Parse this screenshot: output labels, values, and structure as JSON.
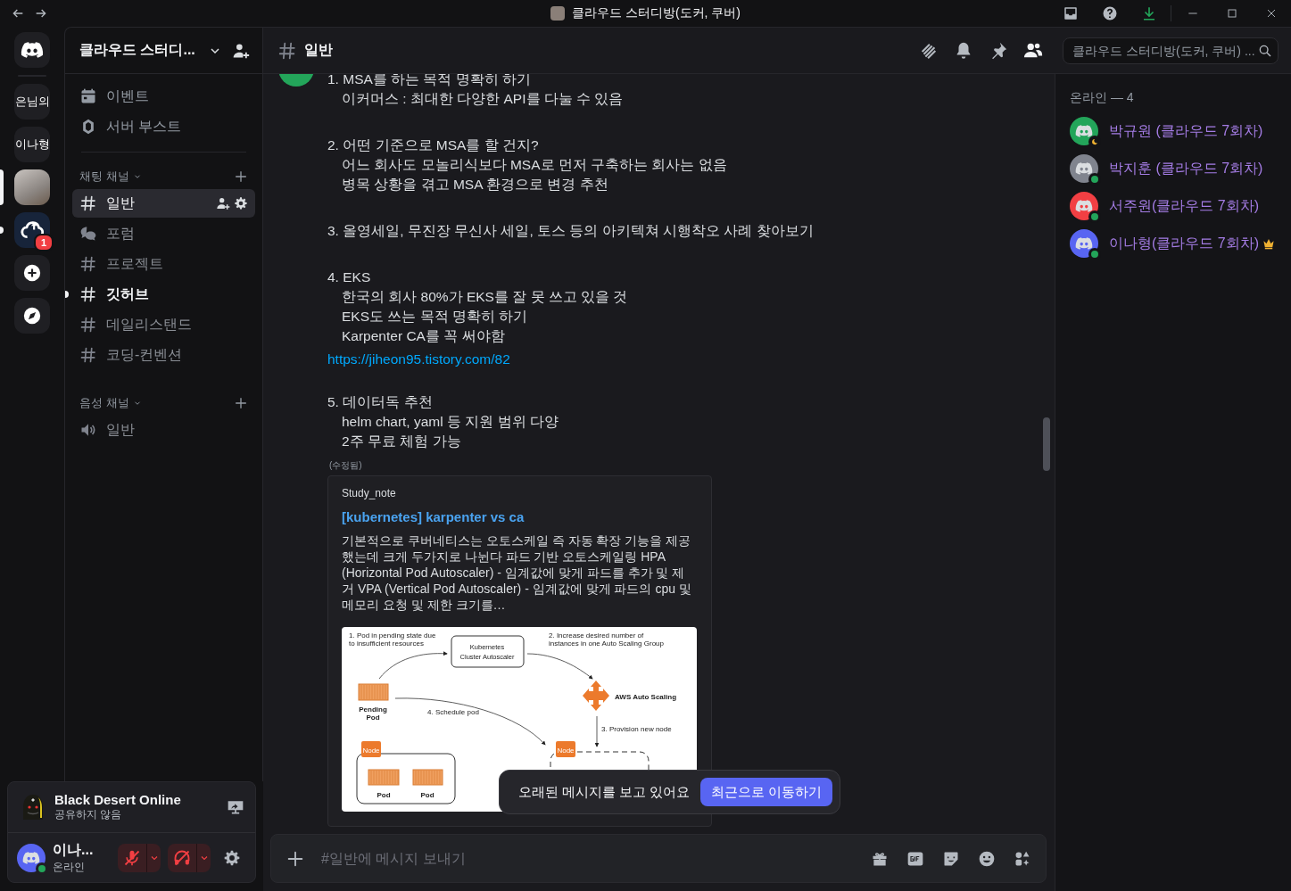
{
  "window": {
    "title": "클라우드 스터디방(도커, 쿠버)"
  },
  "servers": [
    {
      "kind": "home",
      "selected": false,
      "unread": false
    },
    {
      "kind": "text",
      "label": "은님의",
      "selected": false,
      "unread": false
    },
    {
      "kind": "text",
      "label": "이나형",
      "selected": false,
      "unread": false
    },
    {
      "kind": "photo",
      "selected": true,
      "unread": false
    },
    {
      "kind": "cloud",
      "selected": false,
      "unread": true,
      "badge": "1"
    },
    {
      "kind": "add",
      "selected": false,
      "unread": false
    },
    {
      "kind": "discover",
      "selected": false,
      "unread": false
    }
  ],
  "sidebar": {
    "server_name": "클라우드 스터디...",
    "shortcuts": [
      {
        "kind": "events",
        "label": "이벤트"
      },
      {
        "kind": "boost",
        "label": "서버 부스트"
      }
    ],
    "categories": [
      {
        "name": "채팅 채널",
        "channels": [
          {
            "kind": "text",
            "name": "일반",
            "selected": true,
            "unread": false
          },
          {
            "kind": "forum",
            "name": "포럼",
            "selected": false,
            "unread": false
          },
          {
            "kind": "text",
            "name": "프로젝트",
            "selected": false,
            "unread": false
          },
          {
            "kind": "text",
            "name": "깃허브",
            "selected": false,
            "unread": true
          },
          {
            "kind": "text",
            "name": "데일리스탠드",
            "selected": false,
            "unread": false
          },
          {
            "kind": "text",
            "name": "코딩-컨벤션",
            "selected": false,
            "unread": false
          }
        ]
      },
      {
        "name": "음성 채널",
        "channels": [
          {
            "kind": "voice",
            "name": "일반",
            "selected": false,
            "unread": false
          }
        ]
      }
    ]
  },
  "activity": {
    "game": "Black Desert Online",
    "status": "공유하지 않음"
  },
  "user": {
    "name": "이나...",
    "status": "온라인",
    "muted": true,
    "deafened": true
  },
  "header": {
    "channel": "일반",
    "search_placeholder": "클라우드 스터디방(도커, 쿠버) ...",
    "member_list_shown": true
  },
  "message": {
    "blocks": [
      {
        "kind": "text",
        "lines": [
          "1. MSA를 하는 목적 명확히 하기",
          "이커머스 : 최대한 다양한 API를 다눌 수 있음"
        ]
      },
      {
        "kind": "text",
        "lines": [
          "2. 어떤 기준으로 MSA를 할 건지?",
          "어느 회사도 모놀리식보다 MSA로 먼저 구축하는 회사는 없음",
          "병목 상황을 겪고 MSA 환경으로 변경 추천"
        ]
      },
      {
        "kind": "text",
        "lines": [
          "3. 올영세일, 무진장 무신사 세일, 토스 등의 아키텍쳐 시행착오 사례 찾아보기"
        ]
      },
      {
        "kind": "text",
        "lines": [
          "4. EKS",
          "한국의 회사 80%가 EKS를 잘 못 쓰고 있을 것",
          "EKS도 쓰는 목적 명확히 하기",
          "Karpenter CA를 꼭 써야함"
        ]
      },
      {
        "kind": "link",
        "text": "https://jiheon95.tistory.com/82"
      },
      {
        "kind": "text",
        "lines": [
          "5. 데이터독 추천",
          "helm chart, yaml 등 지원 범위 다양",
          "2주 무료 체험 가능"
        ]
      }
    ],
    "edited": "(수정됨)",
    "embed": {
      "provider": "Study_note",
      "title": "[kubernetes] karpenter vs ca",
      "description": "기본적으로 쿠버네티스는 오토스케일 즉 자동 확장 기능을 제공했는데 크게 두가지로 나뉜다 파드 기반 오토스케일링 HPA (Horizontal Pod Autoscaler) - 임계값에 맞게 파드를 추가 및 제거 VPA (Vertical Pod Autoscaler) - 임계값에 맞게 파드의 cpu 및 메모리 요청 및 제한 크기를…",
      "image": {
        "labels": [
          "1. Pod in pending state due",
          "to insufficient resources",
          "Kubernetes",
          "Cluster Autoscaler",
          "2. Increase desired number of",
          "instances in one Auto Scaling Group",
          "AWS Auto Scaling",
          "Pending",
          "Pod",
          "4. Schedule pod",
          "3. Provision new node",
          "Node",
          "Node",
          "Pod",
          "Pod"
        ]
      }
    }
  },
  "toast": {
    "text": "오래된 메시지를 보고 있어요",
    "button": "최근으로 이동하기"
  },
  "composer": {
    "placeholder": "#일반에 메시지 보내기"
  },
  "members": {
    "heading": "온라인 — 4",
    "items": [
      {
        "name": "박규원 (클라우드 7회차)",
        "color": "#23a55a",
        "idle": true,
        "owner": false
      },
      {
        "name": "박지훈 (클라우드 7회차)",
        "color": "#80848e",
        "idle": false,
        "owner": false
      },
      {
        "name": "서주원(클라우드 7회차)",
        "color": "#f23f43",
        "idle": false,
        "owner": false
      },
      {
        "name": "이나형(클라우드 7회차)",
        "color": "#5865f2",
        "idle": false,
        "owner": true
      }
    ]
  }
}
